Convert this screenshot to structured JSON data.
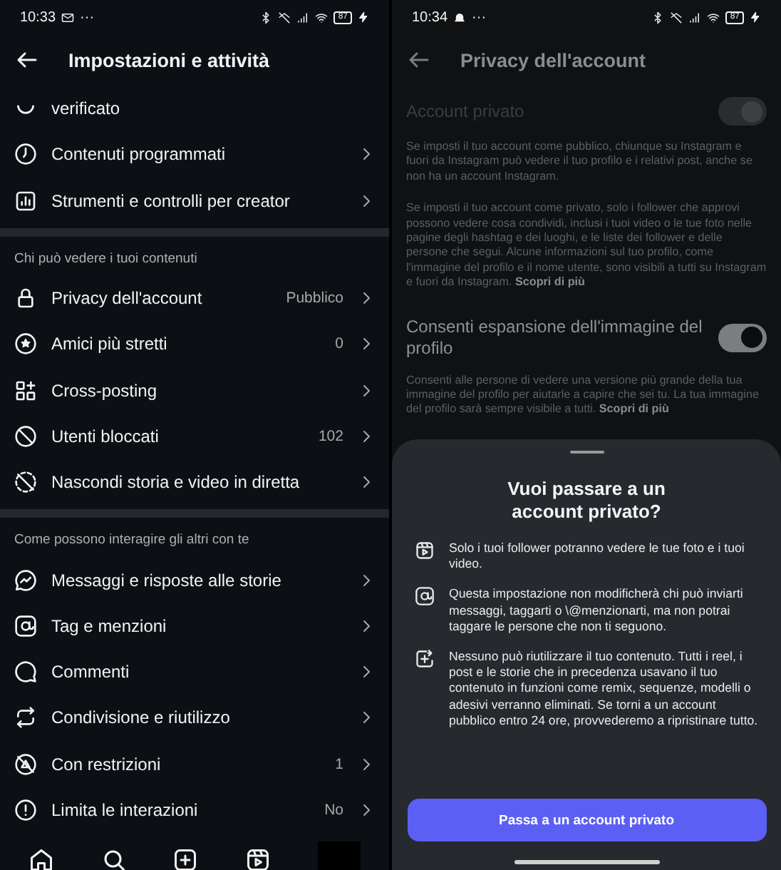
{
  "left": {
    "status_bar": {
      "time": "10:33",
      "dots": "···",
      "battery": "87"
    },
    "header": {
      "title": "Impostazioni e attività"
    },
    "top_rows": [
      {
        "label": "verificato",
        "value": ""
      },
      {
        "label": "Contenuti programmati"
      },
      {
        "label": "Strumenti e controlli per creator"
      }
    ],
    "sections": [
      {
        "title": "Chi può vedere i tuoi contenuti",
        "rows": [
          {
            "label": "Privacy dell'account",
            "value": "Pubblico"
          },
          {
            "label": "Amici più stretti",
            "value": "0"
          },
          {
            "label": "Cross-posting"
          },
          {
            "label": "Utenti bloccati",
            "value": "102"
          },
          {
            "label": "Nascondi storia e video in diretta"
          }
        ]
      },
      {
        "title": "Come possono interagire gli altri con te",
        "rows": [
          {
            "label": "Messaggi e risposte alle storie"
          },
          {
            "label": "Tag e menzioni"
          },
          {
            "label": "Commenti"
          },
          {
            "label": "Condivisione e riutilizzo"
          },
          {
            "label": "Con restrizioni",
            "value": "1"
          },
          {
            "label": "Limita le interazioni",
            "value": "No"
          }
        ]
      }
    ],
    "nav": [
      {
        "kind": "home"
      },
      {
        "kind": "search"
      },
      {
        "kind": "create"
      },
      {
        "kind": "reels"
      },
      {
        "kind": "profile"
      }
    ]
  },
  "right": {
    "status_bar": {
      "time": "10:34",
      "dots": "···",
      "battery": "87"
    },
    "header": {
      "title": "Privacy dell'account"
    },
    "private_row": {
      "label": "Account privato",
      "on": true,
      "disabled": true
    },
    "paragraphs": [
      {
        "text": "Se imposti il tuo account come pubblico, chiunque su Instagram e fuori da Instagram può vedere il tuo profilo e i relativi post, anche se non ha un account Instagram."
      },
      {
        "text": "Se imposti il tuo account come privato, solo i follower che approvi possono vedere cosa condividi, inclusi i tuoi video o le tue foto nelle pagine degli hashtag e dei luoghi, e le liste dei follower e delle persone che segui. Alcune informazioni sul tuo profilo, come l'immagine del profilo e il nome utente, sono visibili a tutti su Instagram e fuori da Instagram.",
        "link": "Scopri di più"
      }
    ],
    "expand_row": {
      "label": "Consenti espansione dell'immagine del profilo",
      "on": true,
      "disabled": false
    },
    "expand_note": {
      "text": "Consenti alle persone di vedere una versione più grande della tua immagine del profilo per aiutarle a capire che sei tu. La tua immagine del profilo sarà sempre visibile a tutti.",
      "link": "Scopri di più"
    },
    "sheet": {
      "title": "Vuoi passare a un account privato?",
      "items": [
        {
          "text": "Solo i tuoi follower potranno vedere le tue foto e i tuoi video."
        },
        {
          "text": "Questa impostazione non modificherà chi può inviarti messaggi, taggarti o \\@menzionarti, ma non potrai taggare le persone che non ti seguono."
        },
        {
          "text": "Nessuno può riutilizzare il tuo contenuto. Tutti i reel, i post e le storie che in precedenza usavano il tuo contenuto in funzioni come remix, sequenze, modelli o adesivi verranno eliminati. Se torni a un account pubblico entro 24 ore, provvederemo a ripristinare tutto."
        }
      ],
      "button": "Passa a un account privato"
    }
  }
}
